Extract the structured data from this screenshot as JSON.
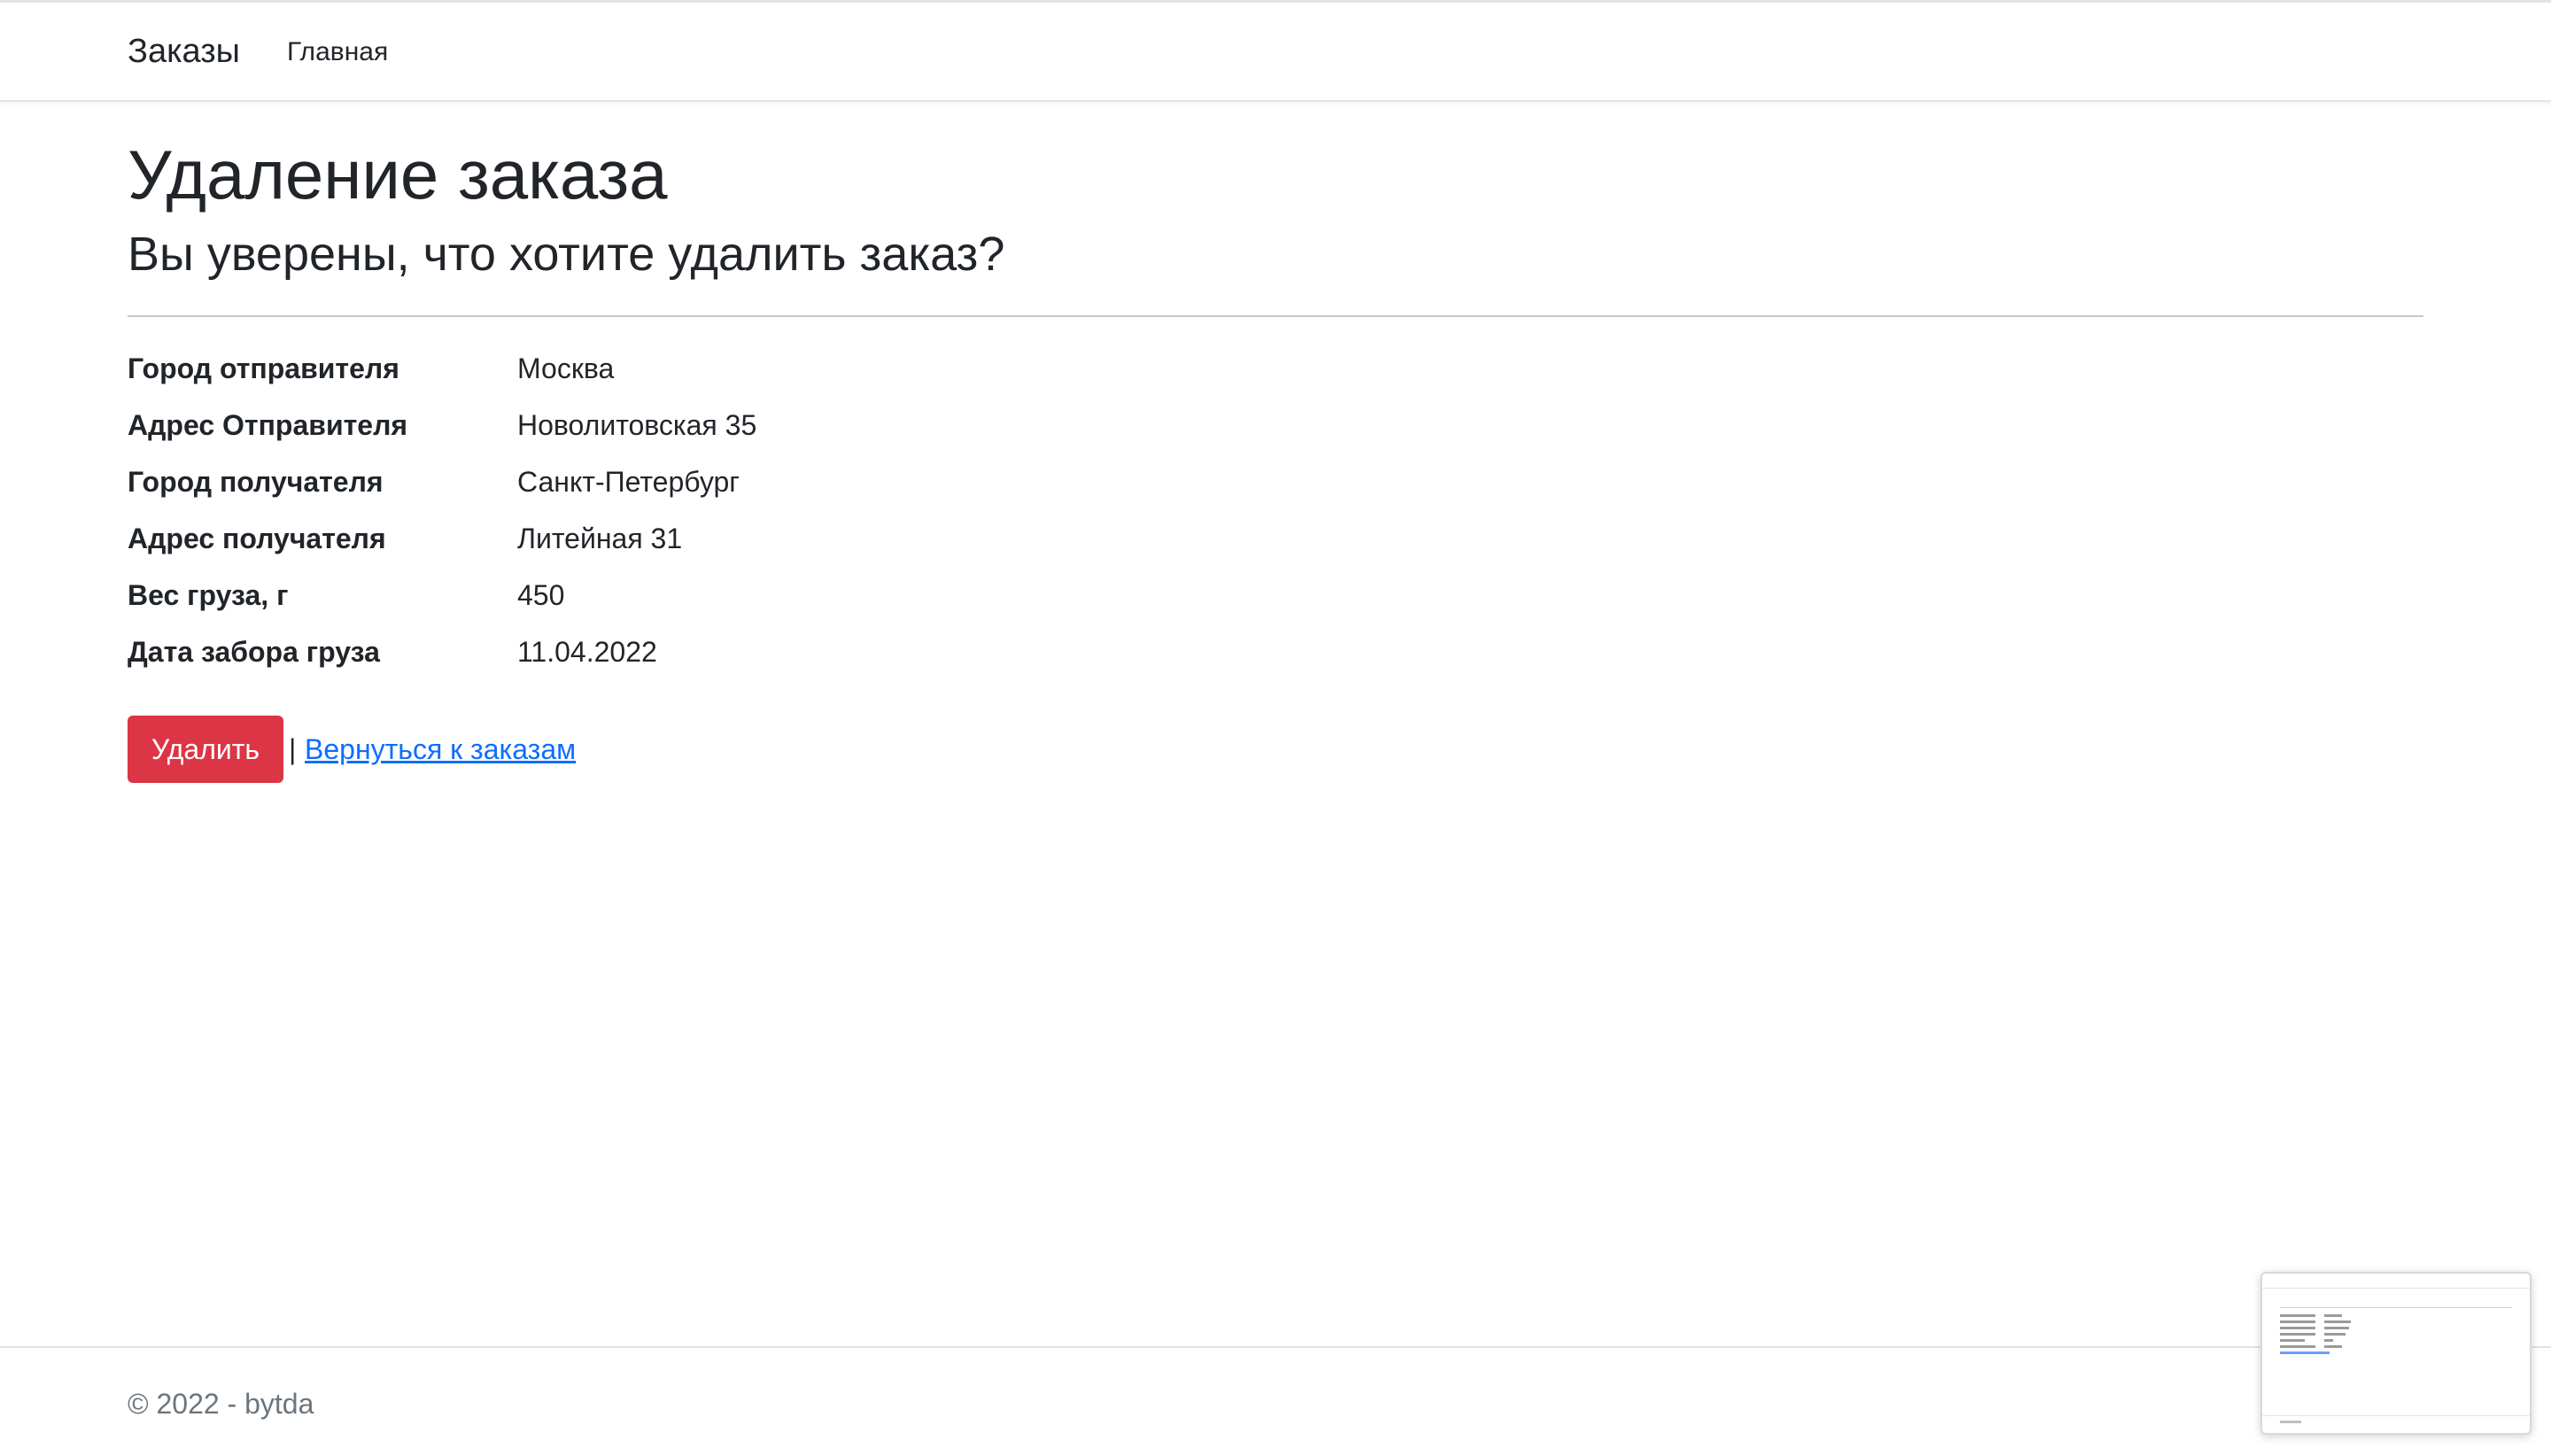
{
  "navbar": {
    "brand": "Заказы",
    "links": [
      {
        "label": "Главная"
      }
    ]
  },
  "page": {
    "title": "Удаление заказа",
    "subtitle": "Вы уверены, что хотите удалить заказ?"
  },
  "details": [
    {
      "label": "Город отправителя",
      "value": "Москва"
    },
    {
      "label": "Адрес Отправителя",
      "value": "Новолитовская 35"
    },
    {
      "label": "Город получателя",
      "value": "Санкт-Петербург"
    },
    {
      "label": "Адрес получателя",
      "value": "Литейная 31"
    },
    {
      "label": "Вес груза, г",
      "value": "450"
    },
    {
      "label": "Дата забора груза",
      "value": "11.04.2022"
    }
  ],
  "actions": {
    "delete_label": "Удалить",
    "separator": "|",
    "back_label": "Вернуться к заказам"
  },
  "footer": {
    "text": "© 2022 - bytda"
  },
  "colors": {
    "danger": "#dc3545",
    "link": "#0d6efd",
    "text": "#212529",
    "muted": "#6c757d"
  }
}
